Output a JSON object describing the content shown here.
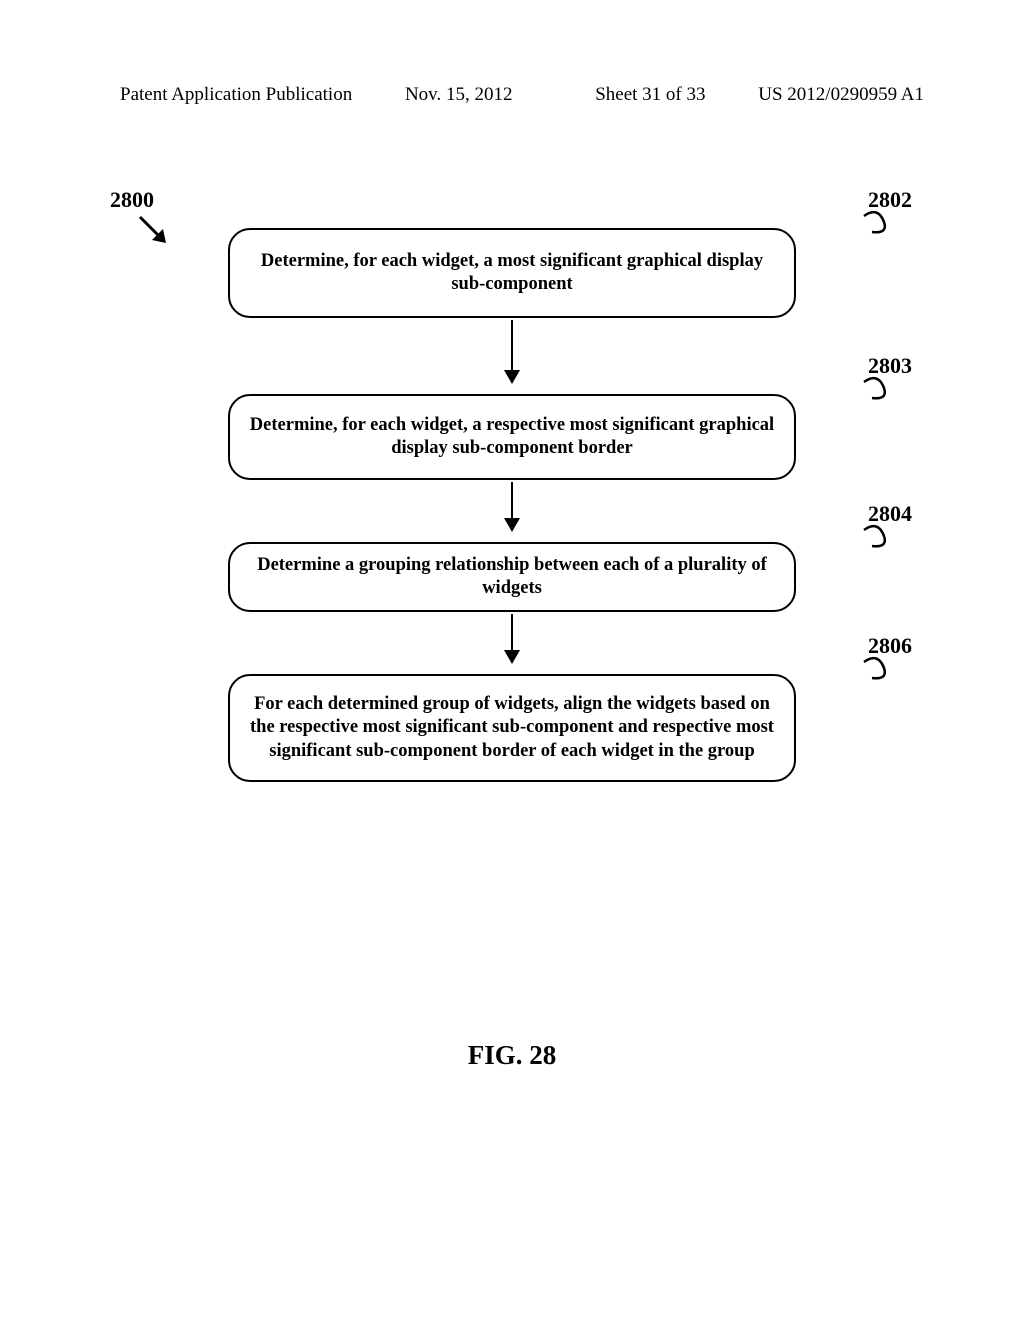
{
  "header": {
    "left": "Patent Application Publication",
    "date": "Nov. 15, 2012",
    "sheet": "Sheet 31 of 33",
    "pubnum": "US 2012/0290959 A1"
  },
  "figure": {
    "overall_ref": "2800",
    "caption": "FIG. 28"
  },
  "steps": [
    {
      "ref": "2802",
      "text": "Determine, for each widget, a most significant graphical display sub-component"
    },
    {
      "ref": "2803",
      "text": "Determine, for each widget, a respective most significant graphical display sub-component border"
    },
    {
      "ref": "2804",
      "text": "Determine a grouping relationship between each of a plurality of widgets"
    },
    {
      "ref": "2806",
      "text": "For each determined group of widgets, align the widgets based on the respective most significant sub-component and respective most significant sub-component border of each widget in the group"
    }
  ]
}
